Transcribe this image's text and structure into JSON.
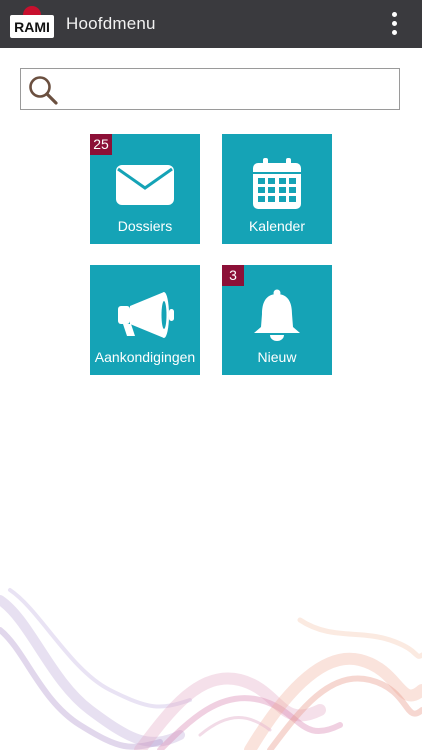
{
  "appbar": {
    "logo_text": "RAMI",
    "title": "Hoofdmenu",
    "overflow_icon": "more-vert-icon",
    "background": "#3a3a3e"
  },
  "search": {
    "icon": "search-icon",
    "value": "",
    "placeholder": ""
  },
  "tiles": [
    {
      "label": "Dossiers",
      "icon": "envelope-icon",
      "badge": "25"
    },
    {
      "label": "Kalender",
      "icon": "calendar-icon",
      "badge": ""
    },
    {
      "label": "Aankondigingen",
      "icon": "megaphone-icon",
      "badge": ""
    },
    {
      "label": "Nieuw",
      "icon": "bell-icon",
      "badge": "3"
    }
  ],
  "colors": {
    "tile": "#15a3b6",
    "badge": "#8c1037",
    "accent_red": "#c8102e"
  }
}
